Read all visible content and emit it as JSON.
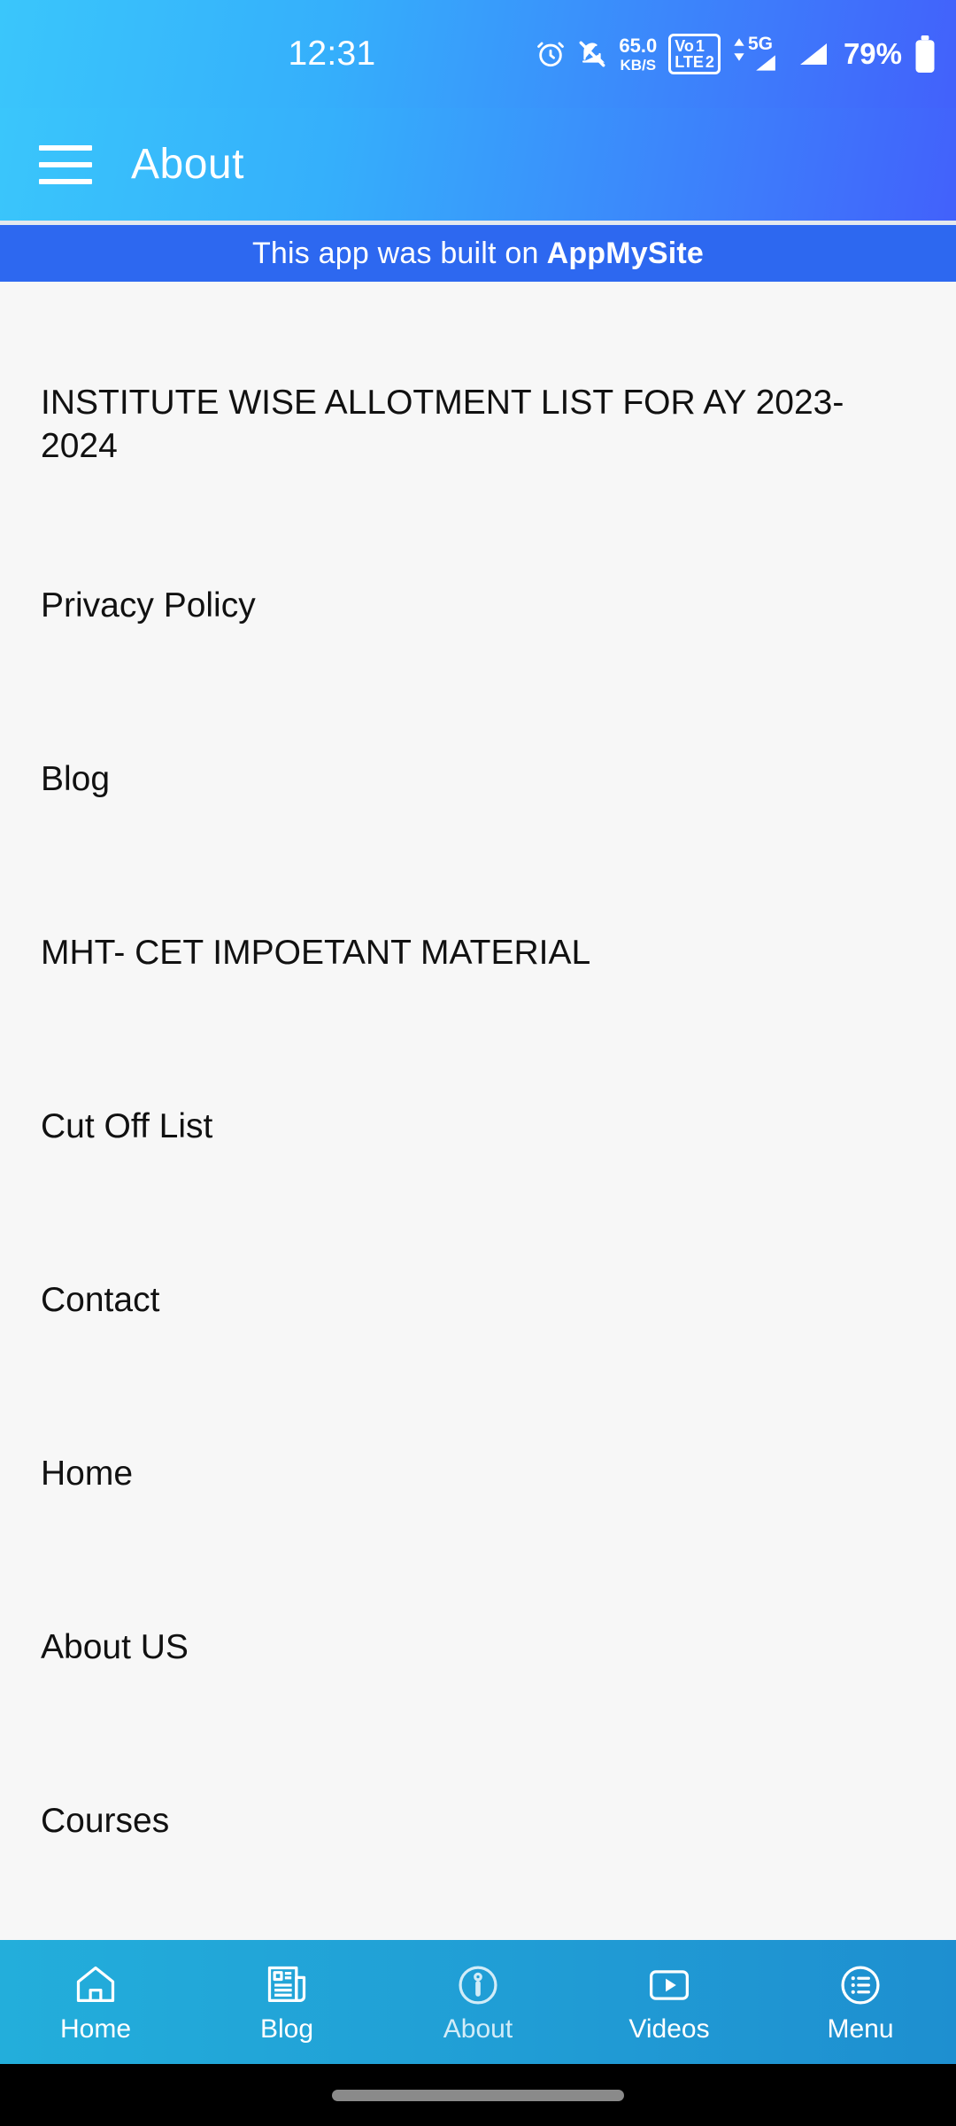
{
  "status_bar": {
    "time": "12:31",
    "network_speed_value": "65.0",
    "network_speed_unit": "KB/S",
    "volte_label": "Vo",
    "lte_label": "LTE",
    "sim1": "1",
    "sim2": "2",
    "network_type": "5G",
    "battery_percent": "79%",
    "icons": [
      "alarm-icon",
      "mute-icon",
      "data-speed-icon",
      "volte-icon",
      "signal-icon",
      "battery-icon"
    ]
  },
  "app_bar": {
    "menu_icon": "hamburger-menu-icon",
    "title": "About",
    "gradient_start": "#3AC6FB",
    "gradient_end": "#4261FB"
  },
  "promo_banner": {
    "prefix": "This app was built on",
    "brand": "AppMySite",
    "background": "#2D68F0"
  },
  "menu_list": {
    "items": [
      {
        "label": "INSTITUTE WISE ALLOTMENT LIST FOR AY 2023-2024",
        "two_line": true
      },
      {
        "label": "Privacy Policy",
        "two_line": false
      },
      {
        "label": "Blog",
        "two_line": false
      },
      {
        "label": "MHT- CET IMPOETANT MATERIAL",
        "two_line": false
      },
      {
        "label": "Cut Off List",
        "two_line": false
      },
      {
        "label": "Contact",
        "two_line": false
      },
      {
        "label": "Home",
        "two_line": false
      },
      {
        "label": "About US",
        "two_line": false
      },
      {
        "label": "Courses",
        "two_line": false
      }
    ]
  },
  "bottom_nav": {
    "background_start": "#23AEDB",
    "background_end": "#1E8FD0",
    "active_index": 2,
    "items": [
      {
        "label": "Home",
        "icon": "home-icon"
      },
      {
        "label": "Blog",
        "icon": "newspaper-icon"
      },
      {
        "label": "About",
        "icon": "info-circle-icon"
      },
      {
        "label": "Videos",
        "icon": "play-video-icon"
      },
      {
        "label": "Menu",
        "icon": "list-circle-icon"
      }
    ]
  },
  "gesture_bar": {
    "handle": "home-gesture-handle",
    "background": "#000000"
  }
}
